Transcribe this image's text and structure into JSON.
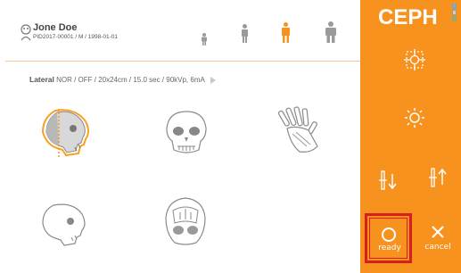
{
  "patient": {
    "name": "Jone Doe",
    "meta": "PID2017-00001 / M / 1998-01-01"
  },
  "size_options": [
    "child",
    "small",
    "medium",
    "large"
  ],
  "size_selected": "medium",
  "protocol": {
    "view": "Lateral",
    "details": " NOR / OFF / 20x24cm / 15.0 sec / 90kVp, 6mA"
  },
  "modes": [
    "lateral-skull",
    "frontal-skull",
    "hand-xray",
    "lateral-skull-2",
    "skull-top"
  ],
  "sidebar": {
    "title": "CEPH",
    "ready_label": "ready",
    "cancel_label": "cancel"
  },
  "colors": {
    "accent": "#f7921e",
    "selected_outline": "#f7a023",
    "highlight_red": "#d81f1f",
    "indicator_1": "#5fb7e4",
    "indicator_2": "#cfcfcf",
    "indicator_3": "#7fc241"
  }
}
